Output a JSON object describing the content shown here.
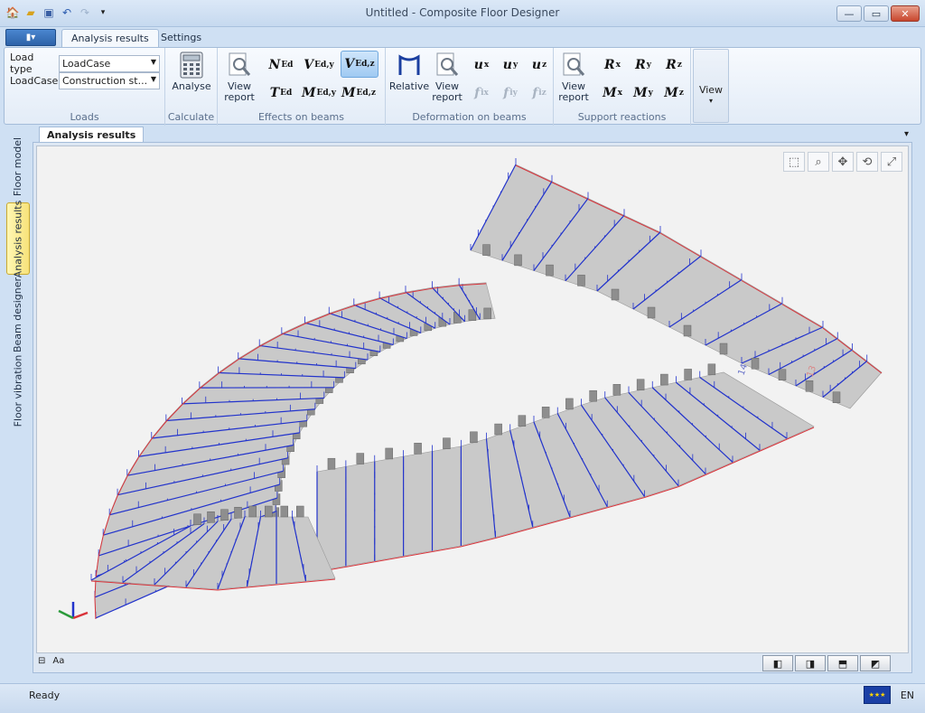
{
  "window": {
    "title": "Untitled - Composite Floor Designer",
    "buttons": {
      "minimize": "—",
      "maximize": "▭",
      "close": "✕"
    }
  },
  "quick_access": [
    "home-icon",
    "open-icon",
    "save-icon",
    "undo-icon",
    "redo-icon",
    "dropdown-icon"
  ],
  "ribbon": {
    "app_menu_label": "▮▾",
    "tabs": [
      {
        "label": "Analysis results",
        "active": true
      },
      {
        "label": "Settings",
        "active": false
      }
    ],
    "loads": {
      "label": "Loads",
      "load_type_label": "Load type",
      "load_type_value": "LoadCase",
      "loadcase_label": "LoadCase",
      "loadcase_value": "Construction st..."
    },
    "calculate": {
      "label": "Calculate",
      "analyse_label": "Analyse"
    },
    "effects": {
      "label": "Effects on beams",
      "view_report_line1": "View",
      "view_report_line2": "report",
      "symbols": [
        {
          "main": "N",
          "sub": "Ed",
          "active": false
        },
        {
          "main": "V",
          "sub": "Ed,y",
          "active": false
        },
        {
          "main": "V",
          "sub": "Ed,z",
          "active": true
        },
        {
          "main": "T",
          "sub": "Ed",
          "active": false
        },
        {
          "main": "M",
          "sub": "Ed,y",
          "active": false
        },
        {
          "main": "M",
          "sub": "Ed,z",
          "active": false
        }
      ]
    },
    "deformation": {
      "label": "Deformation on beams",
      "relative_label": "Relative",
      "view_report_line1": "View",
      "view_report_line2": "report",
      "symbols": [
        {
          "main": "u",
          "sub": "x",
          "enabled": true
        },
        {
          "main": "u",
          "sub": "y",
          "enabled": true
        },
        {
          "main": "u",
          "sub": "z",
          "enabled": true
        },
        {
          "main": "f",
          "sub": "ix",
          "enabled": false
        },
        {
          "main": "f",
          "sub": "iy",
          "enabled": false
        },
        {
          "main": "f",
          "sub": "iz",
          "enabled": false
        }
      ]
    },
    "support": {
      "label": "Support reactions",
      "view_report_line1": "View",
      "view_report_line2": "report",
      "symbols": [
        {
          "main": "R",
          "sub": "x"
        },
        {
          "main": "R",
          "sub": "y"
        },
        {
          "main": "R",
          "sub": "z"
        },
        {
          "main": "M",
          "sub": "x"
        },
        {
          "main": "M",
          "sub": "y"
        },
        {
          "main": "M",
          "sub": "z"
        }
      ]
    },
    "view": {
      "label": "View"
    }
  },
  "side_tabs": [
    {
      "label": "Floor model",
      "active": false
    },
    {
      "label": "Analysis results",
      "active": true
    },
    {
      "label": "Beam designer",
      "active": false
    },
    {
      "label": "Floor vibration",
      "active": false
    }
  ],
  "document": {
    "tab_label": "Analysis results",
    "viewport_tools": [
      "zoom-window-icon",
      "zoom-icon",
      "pan-icon",
      "orbit-icon",
      "fit-all-icon"
    ],
    "bottom_left": {
      "ruler": "⊟",
      "font": "Aa"
    },
    "view_cubes": [
      "front-view",
      "side-view",
      "top-view",
      "iso-view"
    ],
    "beam_labels": [
      "14",
      "13"
    ]
  },
  "status": {
    "text": "Ready",
    "language": "EN"
  },
  "colors": {
    "blue_diagram": "#2233cc",
    "red_diagram": "#d9333a",
    "panel_fill": "#c9c9c9",
    "viewport_bg": "#f2f2f2",
    "active_vtab": "#f7e27a"
  }
}
